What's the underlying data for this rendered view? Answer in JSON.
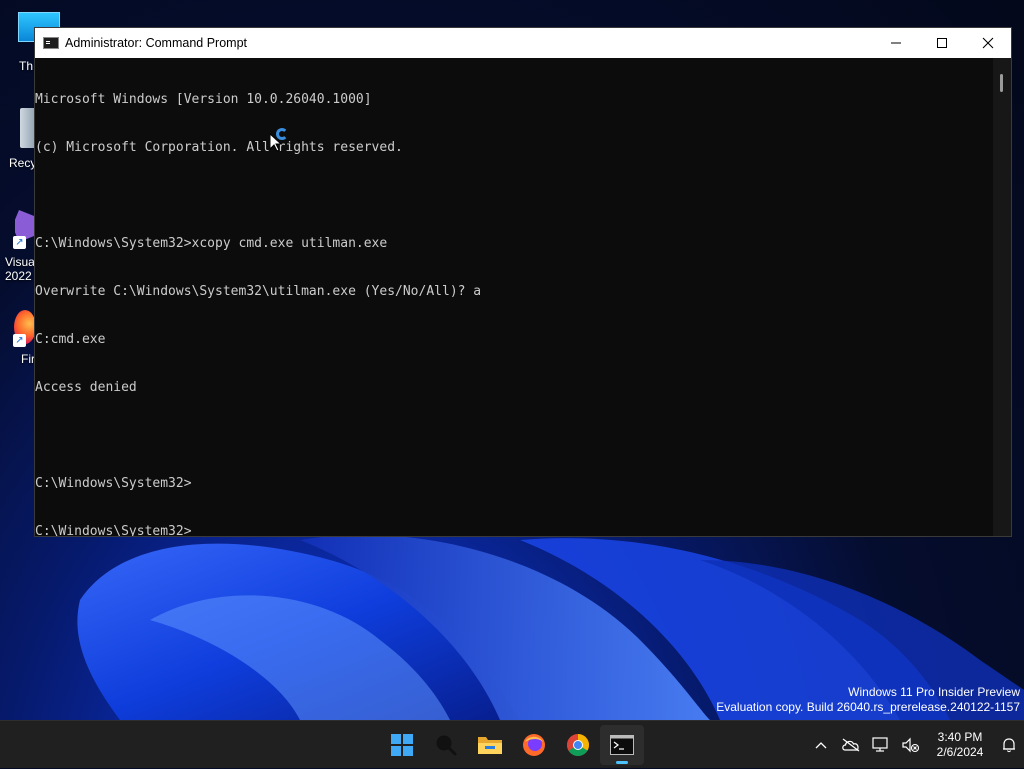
{
  "desktop": {
    "icons": [
      {
        "label": "Th"
      },
      {
        "label": "Recy"
      },
      {
        "label": "Visua",
        "label2": "2022 I"
      },
      {
        "label": "Fir"
      }
    ],
    "watermark": {
      "line1": "Windows 11 Pro Insider Preview",
      "line2": "Evaluation copy. Build 26040.rs_prerelease.240122-1157"
    }
  },
  "window": {
    "title": "Administrator: Command Prompt",
    "minimize_label": "—",
    "maximize_label": "☐",
    "close_label": "✕",
    "console_lines": [
      "Microsoft Windows [Version 10.0.26040.1000]",
      "(c) Microsoft Corporation. All rights reserved.",
      "",
      "C:\\Windows\\System32>xcopy cmd.exe utilman.exe",
      "Overwrite C:\\Windows\\System32\\utilman.exe (Yes/No/All)? a",
      "C:cmd.exe",
      "Access denied",
      "",
      "C:\\Windows\\System32>",
      "C:\\Windows\\System32>"
    ]
  },
  "taskbar": {
    "apps": [
      {
        "name": "start-icon"
      },
      {
        "name": "search-icon"
      },
      {
        "name": "file-explorer-icon"
      },
      {
        "name": "firefox-icon"
      },
      {
        "name": "chrome-icon"
      },
      {
        "name": "terminal-icon",
        "active": true
      }
    ],
    "clock": {
      "time": "3:40 PM",
      "date": "2/6/2024"
    }
  },
  "colors": {
    "console_bg": "#0c0c0c",
    "console_text": "#cccccc",
    "taskbar_bg": "#202020",
    "accent": "#4cc2ff"
  }
}
